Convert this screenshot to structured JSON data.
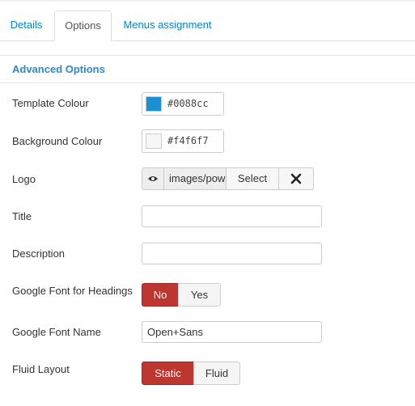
{
  "tabs": {
    "details": "Details",
    "options": "Options",
    "menus": "Menus assignment"
  },
  "section": {
    "legend": "Advanced Options"
  },
  "fields": {
    "template_colour": {
      "label": "Template Colour",
      "value": "#0088cc",
      "swatch": "#1b8fd0"
    },
    "background_colour": {
      "label": "Background Colour",
      "value": "#f4f6f7",
      "swatch": "#f4f6f7"
    },
    "logo": {
      "label": "Logo",
      "path": "images/powered_by.png",
      "select_label": "Select",
      "preview_icon": "eye-icon",
      "clear_icon": "close-icon"
    },
    "title": {
      "label": "Title",
      "value": ""
    },
    "description": {
      "label": "Description",
      "value": ""
    },
    "google_font_headings": {
      "label": "Google Font for Headings",
      "options": [
        "No",
        "Yes"
      ],
      "selected": "No"
    },
    "google_font_name": {
      "label": "Google Font Name",
      "value": "Open+Sans"
    },
    "fluid_layout": {
      "label": "Fluid Layout",
      "options": [
        "Static",
        "Fluid"
      ],
      "selected": "Static"
    }
  },
  "colors": {
    "accent": "#0088cc",
    "legend": "#2e89c7",
    "toggle_active": "#bd362f"
  }
}
